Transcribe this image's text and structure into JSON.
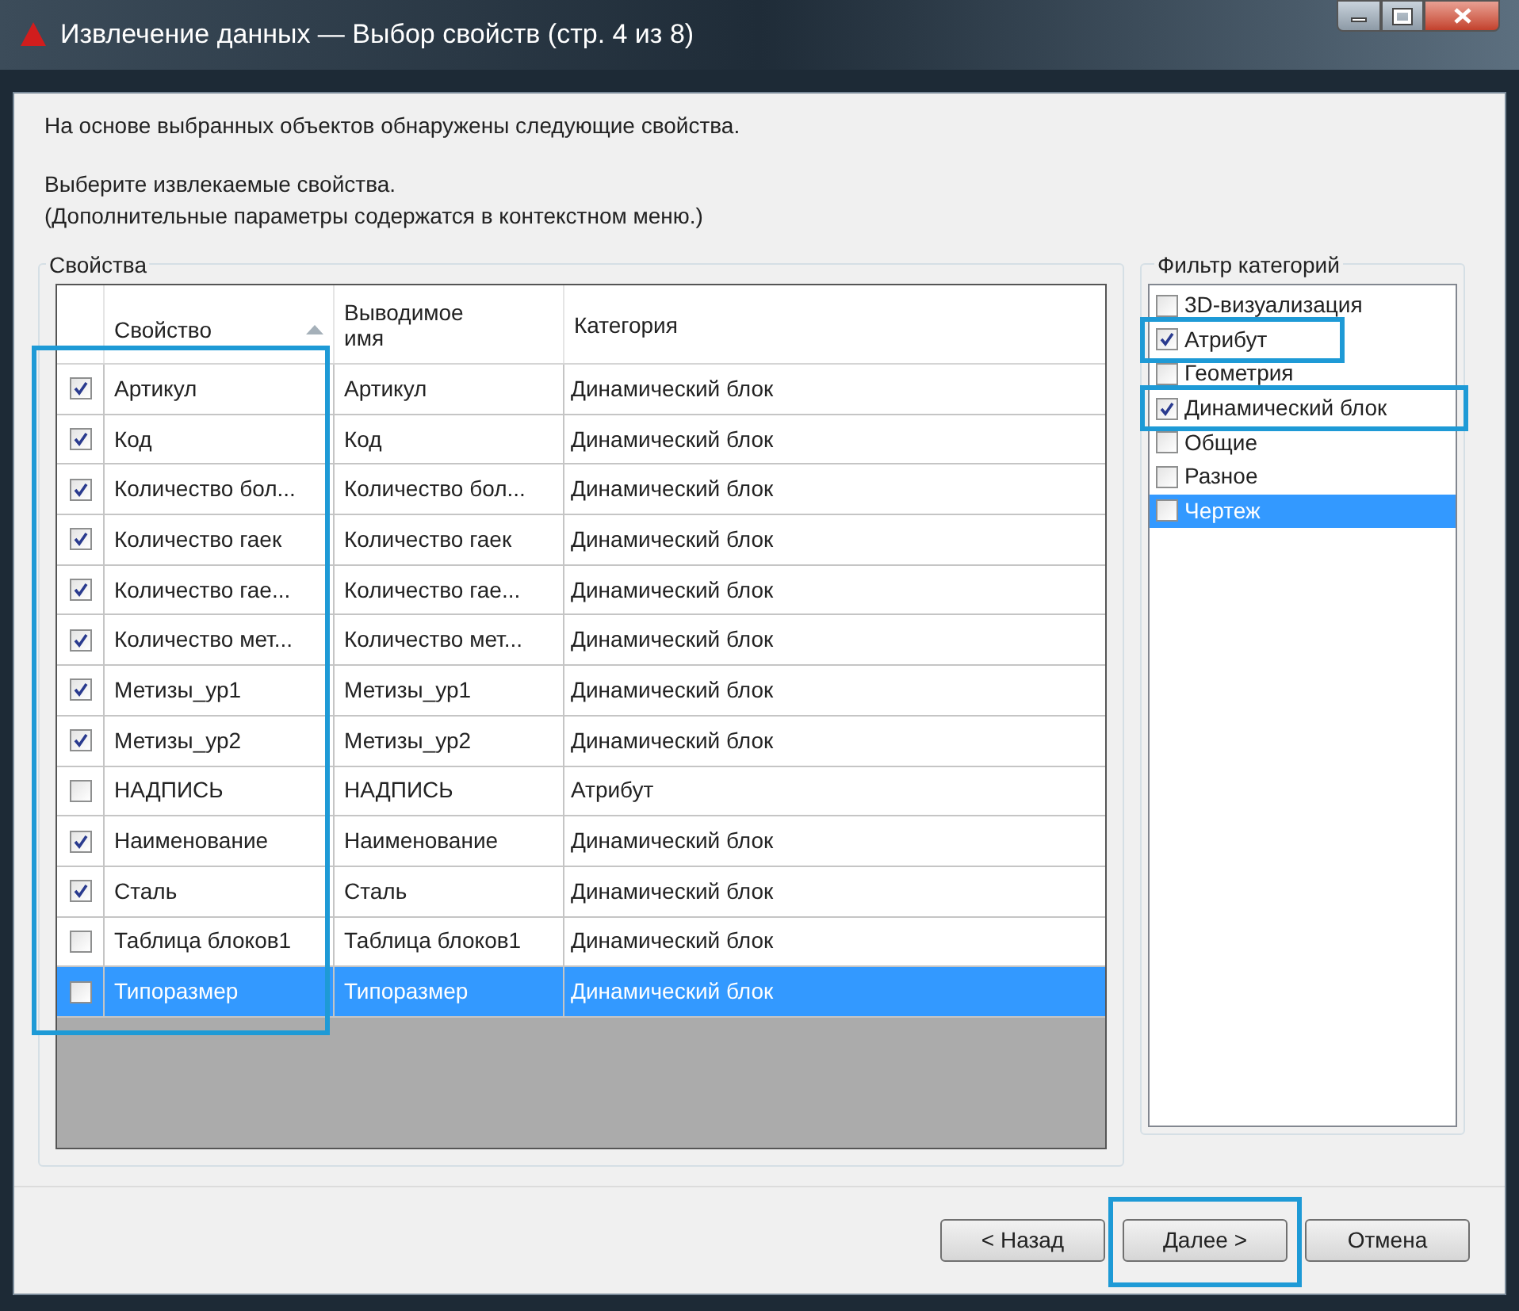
{
  "window": {
    "title": "Извлечение данных — Выбор свойств (стр. 4 из 8)"
  },
  "intro": "На основе выбранных объектов обнаружены следующие свойства.",
  "instructions": [
    "Выберите извлекаемые свойства.",
    "(Дополнительные параметры содержатся в контекстном меню.)"
  ],
  "properties": {
    "title": "Свойства",
    "highlight_checkbox_column": true,
    "columns": [
      {
        "label": "Свойство",
        "sorted": true
      },
      {
        "label": "Выводимое имя",
        "sorted": false
      },
      {
        "label": "Категория",
        "sorted": false
      }
    ],
    "rows": [
      {
        "checked": true,
        "selected": false,
        "property": "Артикул",
        "display_name": "Артикул",
        "category": "Динамический блок"
      },
      {
        "checked": true,
        "selected": false,
        "property": "Код",
        "display_name": "Код",
        "category": "Динамический блок"
      },
      {
        "checked": true,
        "selected": false,
        "property": "Количество бол...",
        "display_name": "Количество бол...",
        "category": "Динамический блок"
      },
      {
        "checked": true,
        "selected": false,
        "property": "Количество гаек",
        "display_name": "Количество гаек",
        "category": "Динамический блок"
      },
      {
        "checked": true,
        "selected": false,
        "property": "Количество гае...",
        "display_name": "Количество гае...",
        "category": "Динамический блок"
      },
      {
        "checked": true,
        "selected": false,
        "property": "Количество мет...",
        "display_name": "Количество мет...",
        "category": "Динамический блок"
      },
      {
        "checked": true,
        "selected": false,
        "property": "Метизы_ур1",
        "display_name": "Метизы_ур1",
        "category": "Динамический блок"
      },
      {
        "checked": true,
        "selected": false,
        "property": "Метизы_ур2",
        "display_name": "Метизы_ур2",
        "category": "Динамический блок"
      },
      {
        "checked": false,
        "selected": false,
        "property": "НАДПИСЬ",
        "display_name": "НАДПИСЬ",
        "category": "Атрибут"
      },
      {
        "checked": true,
        "selected": false,
        "property": "Наименование",
        "display_name": "Наименование",
        "category": "Динамический блок"
      },
      {
        "checked": true,
        "selected": false,
        "property": "Сталь",
        "display_name": "Сталь",
        "category": "Динамический блок"
      },
      {
        "checked": false,
        "selected": false,
        "property": "Таблица блоков1",
        "display_name": "Таблица блоков1",
        "category": "Динамический блок"
      },
      {
        "checked": false,
        "selected": true,
        "property": "Типоразмер",
        "display_name": "Типоразмер",
        "category": "Динамический блок"
      }
    ]
  },
  "category_filter": {
    "title": "Фильтр категорий",
    "items": [
      {
        "label": "3D-визуализация",
        "checked": false,
        "selected": false,
        "highlighted": false
      },
      {
        "label": "Атрибут",
        "checked": true,
        "selected": false,
        "highlighted": true
      },
      {
        "label": "Геометрия",
        "checked": false,
        "selected": false,
        "highlighted": false
      },
      {
        "label": "Динамический блок",
        "checked": true,
        "selected": false,
        "highlighted": true
      },
      {
        "label": "Общие",
        "checked": false,
        "selected": false,
        "highlighted": false
      },
      {
        "label": "Разное",
        "checked": false,
        "selected": false,
        "highlighted": false
      },
      {
        "label": "Чертеж",
        "checked": false,
        "selected": true,
        "highlighted": false
      }
    ]
  },
  "buttons": [
    {
      "label": "< Назад",
      "highlighted": false
    },
    {
      "label": "Далее >",
      "highlighted": true
    },
    {
      "label": "Отмена",
      "highlighted": false
    }
  ]
}
